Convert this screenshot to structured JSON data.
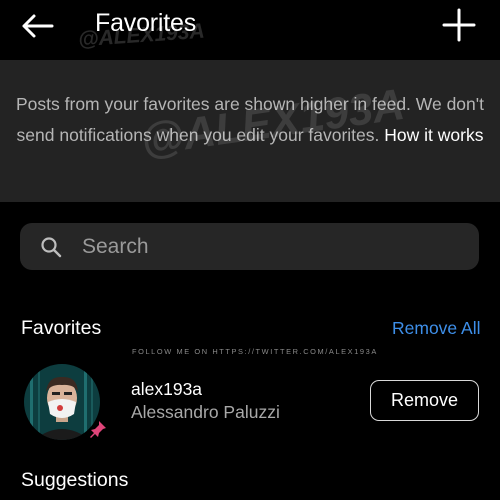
{
  "header": {
    "title": "Favorites",
    "back_icon": "arrow-left-icon",
    "add_icon": "plus-icon"
  },
  "watermark": {
    "small": "@ALEX193A",
    "large": "@ALEX193A"
  },
  "info": {
    "text": "Posts from your favorites are shown higher in feed. We don't send notifications when you edit your favorites.",
    "link": "How it works"
  },
  "search": {
    "placeholder": "Search",
    "value": ""
  },
  "favorites": {
    "title": "Favorites",
    "remove_all": "Remove All",
    "note": "FOLLOW ME ON HTTPS://TWITTER.COM/ALEX193A",
    "items": [
      {
        "username": "alex193a",
        "full_name": "Alessandro Paluzzi",
        "action": "Remove"
      }
    ]
  },
  "suggestions": {
    "title": "Suggestions"
  },
  "colors": {
    "background": "#000000",
    "banner": "#232323",
    "search_bg": "#262626",
    "link_blue": "#3e8fe9",
    "muted_text": "#a8a8a8"
  }
}
